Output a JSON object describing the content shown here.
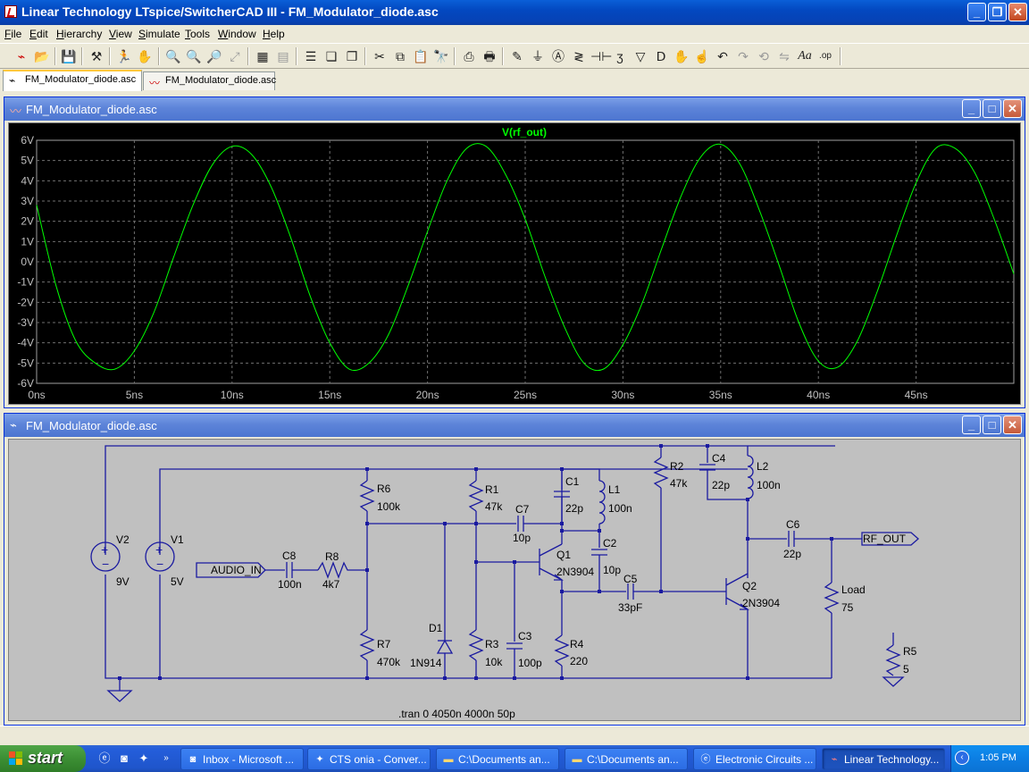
{
  "app": {
    "title": "Linear Technology LTspice/SwitcherCAD III - FM_Modulator_diode.asc"
  },
  "menu": [
    "File",
    "Edit",
    "Hierarchy",
    "View",
    "Simulate",
    "Tools",
    "Window",
    "Help"
  ],
  "toolbar": {
    "icons": [
      "new-schematic-icon",
      "open-icon",
      "save-icon",
      "control-panel-icon",
      "run-icon",
      "halt-icon",
      "zoom-in-icon",
      "zoom-pan-icon",
      "zoom-out-icon",
      "zoom-fit-icon",
      "autorange-icon",
      "mark-unsorted-icon",
      "tile-horizontal-icon",
      "cascade-icon",
      "tile-vertical-icon",
      "cut-icon",
      "copy-icon",
      "paste-icon",
      "find-icon",
      "print-setup-icon",
      "print-icon",
      "draw-wire-icon",
      "ground-icon",
      "label-net-icon",
      "resistor-icon",
      "capacitor-icon",
      "inductor-icon",
      "diode-icon",
      "component-icon",
      "move-icon",
      "drag-icon",
      "undo-icon",
      "redo-icon",
      "rotate-icon",
      "mirror-icon",
      "text-icon",
      "spice-directive-icon"
    ],
    "text_tool": "Aa",
    "op_tool": ".op"
  },
  "tabs": [
    {
      "label": "FM_Modulator_diode.asc",
      "active": true
    },
    {
      "label": "FM_Modulator_diode.asc",
      "active": false
    }
  ],
  "waveform_window": {
    "title": "FM_Modulator_diode.asc"
  },
  "schematic_window": {
    "title": "FM_Modulator_diode.asc",
    "directive": ".tran 0 4050n 4000n 50p",
    "labels": {
      "v2": "V2",
      "v2_val": "9V",
      "v1": "V1",
      "v1_val": "5V",
      "audio_in": "AUDIO_IN",
      "c8": "C8",
      "c8_val": "100n",
      "r8": "R8",
      "r8_val": "4k7",
      "r6": "R6",
      "r6_val": "100k",
      "r7": "R7",
      "r7_val": "470k",
      "d1": "D1",
      "d1_val": "1N914",
      "r1": "R1",
      "r1_val": "47k",
      "r3": "R3",
      "r3_val": "10k",
      "c3": "C3",
      "c3_val": "100p",
      "c7": "C7",
      "c7_val": "10p",
      "c1": "C1",
      "c1_val": "22p",
      "l1": "L1",
      "l1_val": "100n",
      "q1": "Q1",
      "q1_val": "2N3904",
      "c2": "C2",
      "c2_val": "10p",
      "r4": "R4",
      "r4_val": "220",
      "c5": "C5",
      "c5_val": "33pF",
      "r2": "R2",
      "r2_val": "47k",
      "c4": "C4",
      "c4_val": "22p",
      "l2": "L2",
      "l2_val": "100n",
      "q2": "Q2",
      "q2_val": "2N3904",
      "c6": "C6",
      "c6_val": "22p",
      "rf_out": "RF_OUT",
      "load": "Load",
      "load_val": "75",
      "r5": "R5",
      "r5_val": "5"
    }
  },
  "chart_data": {
    "type": "line",
    "title": "V(rf_out)",
    "xlabel": "",
    "ylabel": "",
    "xlim": [
      0,
      50
    ],
    "ylim": [
      -6,
      6
    ],
    "x_ticks": [
      "0ns",
      "5ns",
      "10ns",
      "15ns",
      "20ns",
      "25ns",
      "30ns",
      "35ns",
      "40ns",
      "45ns"
    ],
    "y_ticks": [
      "6V",
      "5V",
      "4V",
      "3V",
      "2V",
      "1V",
      "0V",
      "-1V",
      "-2V",
      "-3V",
      "-4V",
      "-5V",
      "-6V"
    ],
    "grid": true,
    "series": [
      {
        "name": "V(rf_out)",
        "color": "#00ff00",
        "x": [
          0,
          1,
          2,
          3,
          4,
          5,
          6,
          7,
          8,
          9,
          10,
          11,
          12,
          13,
          14,
          15,
          16,
          17,
          18,
          19,
          20,
          21,
          22,
          23,
          24,
          25,
          26,
          27,
          28,
          29,
          30,
          31,
          32,
          33,
          34,
          35,
          36,
          37,
          38,
          39,
          40,
          41,
          42,
          43,
          44,
          45,
          46,
          47,
          48,
          49,
          50
        ],
        "values": [
          2.8,
          -1.2,
          -3.9,
          -5.0,
          -5.3,
          -4.4,
          -2.5,
          0.2,
          2.8,
          4.8,
          5.7,
          5.3,
          3.7,
          1.2,
          -1.7,
          -4.0,
          -5.3,
          -5.0,
          -3.6,
          -1.2,
          1.5,
          4.0,
          5.6,
          5.7,
          4.3,
          2.1,
          -0.7,
          -3.2,
          -5.0,
          -5.3,
          -4.1,
          -2.0,
          0.7,
          3.3,
          5.2,
          5.8,
          4.8,
          2.5,
          -0.2,
          -3.0,
          -4.9,
          -5.2,
          -3.9,
          -1.5,
          1.3,
          3.9,
          5.6,
          5.6,
          4.4,
          2.1,
          -0.6
        ]
      }
    ]
  },
  "taskbar": {
    "start": "start",
    "quick_launch": [
      "ie-icon",
      "outlook-icon",
      "app-icon"
    ],
    "buttons": [
      {
        "label": "Inbox - Microsoft ...",
        "icon": "outlook-icon",
        "active": false
      },
      {
        "label": "CTS onia - Conver...",
        "icon": "app-icon",
        "active": false
      },
      {
        "label": "C:\\Documents an...",
        "icon": "folder-icon",
        "active": false
      },
      {
        "label": "C:\\Documents an...",
        "icon": "folder-icon",
        "active": false
      },
      {
        "label": "Electronic Circuits ...",
        "icon": "ie-icon",
        "active": false
      },
      {
        "label": "Linear Technology...",
        "icon": "ltspice-icon",
        "active": true
      }
    ],
    "clock": "1:05 PM"
  }
}
